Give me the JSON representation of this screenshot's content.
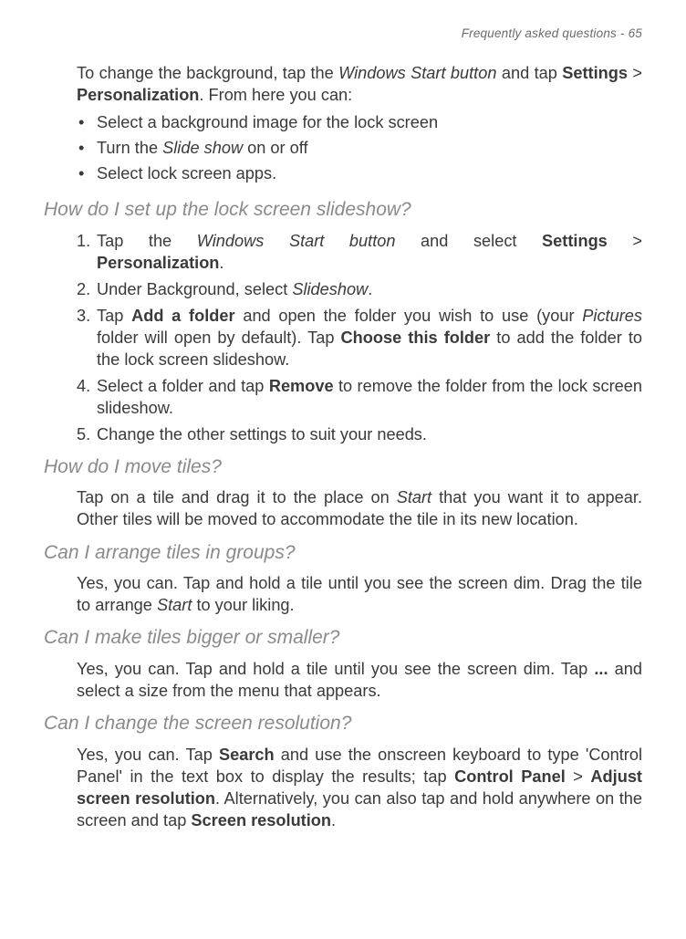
{
  "header": "Frequently asked questions - 65",
  "intro": {
    "pre": "To change the background, tap the ",
    "italic1": "Windows Start button",
    "mid1": " and tap ",
    "bold1": "Settings",
    "gt1": " > ",
    "bold2": "Personalization",
    "post": ". From here you can:"
  },
  "bullets": {
    "b1_pre": "Select a background image for the lock screen",
    "b2_pre": "Turn the ",
    "b2_it": "Slide show",
    "b2_post": " on or off",
    "b3": "Select lock screen apps."
  },
  "h1": "How do I set up the lock screen slideshow?",
  "steps": {
    "s1_pre": "Tap the ",
    "s1_it": "Windows Start button",
    "s1_mid": " and select ",
    "s1_b1": "Settings",
    "s1_gt": " > ",
    "s1_b2": "Personalization",
    "s1_post": ".",
    "s2_pre": "Under Background, select ",
    "s2_it": "Slideshow",
    "s2_post": ".",
    "s3_pre": "Tap ",
    "s3_b1": "Add a folder",
    "s3_mid1": " and open the folder you wish to use (your ",
    "s3_it": "Pictures",
    "s3_mid2": " folder will open by default). Tap ",
    "s3_b2": "Choose this folder",
    "s3_post": " to add the folder to the lock screen slideshow.",
    "s4_pre": "Select a folder and tap ",
    "s4_b1": "Remove",
    "s4_post": " to remove the folder from the lock screen slideshow.",
    "s5": "Change the other settings to suit your needs."
  },
  "h2": "How do I move tiles?",
  "p2_pre": "Tap on a tile and drag it to the place on ",
  "p2_it": "Start",
  "p2_post": " that you want it to appear. Other tiles will be moved to accommodate the tile in its new location.",
  "h3": "Can I arrange tiles in groups?",
  "p3_pre": "Yes, you can. Tap and hold a tile until you see the screen dim. Drag the tile to arrange ",
  "p3_it": "Start",
  "p3_post": " to your liking.",
  "h4": "Can I make tiles bigger or smaller?",
  "p4_pre": "Yes, you can. Tap and hold a tile until you see the screen dim. Tap ",
  "p4_b": "...",
  "p4_post": " and select a size from the menu that appears.",
  "h5": "Can I change the screen resolution?",
  "p5_pre": "Yes, you can. Tap ",
  "p5_b1": "Search",
  "p5_mid1": " and use the onscreen keyboard to type 'Control Panel' in the text box to display the results; tap ",
  "p5_b2": "Control Panel",
  "p5_gt": " > ",
  "p5_b3": "Adjust screen resolution",
  "p5_mid2": ". Alternatively, you can also tap and hold anywhere on the screen and tap ",
  "p5_b4": "Screen resolution",
  "p5_post": "."
}
